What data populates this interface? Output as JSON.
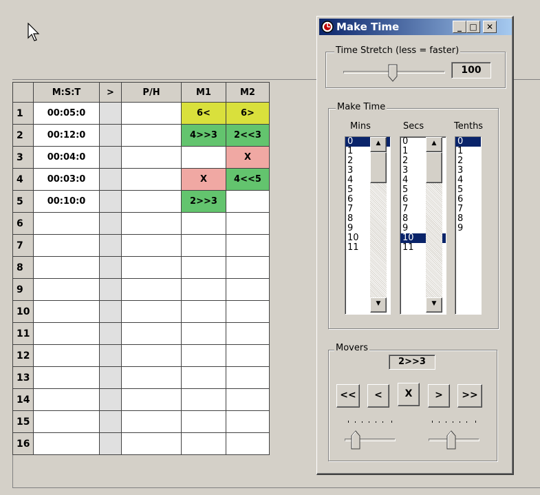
{
  "grid": {
    "headers": [
      "",
      "M:S:T",
      ">",
      "P/H",
      "M1",
      "M2"
    ],
    "rows": [
      {
        "num": "1",
        "time": "00:05:0",
        "m1": "6<",
        "m2": "6>"
      },
      {
        "num": "2",
        "time": "00:12:0",
        "m1": "4>>3",
        "m2": "2<<3"
      },
      {
        "num": "3",
        "time": "00:04:0",
        "m1": "",
        "m2": "X"
      },
      {
        "num": "4",
        "time": "00:03:0",
        "m1": "X",
        "m2": "4<<5"
      },
      {
        "num": "5",
        "time": "00:10:0",
        "m1": "2>>3",
        "m2": ""
      },
      {
        "num": "6",
        "time": "",
        "m1": "",
        "m2": ""
      },
      {
        "num": "7",
        "time": "",
        "m1": "",
        "m2": ""
      },
      {
        "num": "8",
        "time": "",
        "m1": "",
        "m2": ""
      },
      {
        "num": "9",
        "time": "",
        "m1": "",
        "m2": ""
      },
      {
        "num": "10",
        "time": "",
        "m1": "",
        "m2": ""
      },
      {
        "num": "11",
        "time": "",
        "m1": "",
        "m2": ""
      },
      {
        "num": "12",
        "time": "",
        "m1": "",
        "m2": ""
      },
      {
        "num": "13",
        "time": "",
        "m1": "",
        "m2": ""
      },
      {
        "num": "14",
        "time": "",
        "m1": "",
        "m2": ""
      },
      {
        "num": "15",
        "time": "",
        "m1": "",
        "m2": ""
      },
      {
        "num": "16",
        "time": "",
        "m1": "",
        "m2": ""
      }
    ]
  },
  "window": {
    "title": "Make Time",
    "minimize": "_",
    "maximize": "□",
    "close": "✕"
  },
  "stretch": {
    "label": "Time Stretch (less = faster)",
    "value": "100"
  },
  "make_time": {
    "label": "Make Time",
    "mins_label": "Mins",
    "secs_label": "Secs",
    "tenths_label": "Tenths",
    "mins": [
      "0",
      "1",
      "2",
      "3",
      "4",
      "5",
      "6",
      "7",
      "8",
      "9",
      "10",
      "11"
    ],
    "secs": [
      "0",
      "1",
      "2",
      "3",
      "4",
      "5",
      "6",
      "7",
      "8",
      "9",
      "10",
      "11"
    ],
    "tenths": [
      "0",
      "1",
      "2",
      "3",
      "4",
      "5",
      "6",
      "7",
      "8",
      "9"
    ],
    "mins_selected": "0",
    "secs_selected": "10",
    "tenths_selected": "0"
  },
  "movers": {
    "label": "Movers",
    "current": "2>>3",
    "buttons": [
      "<<",
      "<",
      "X",
      ">",
      ">>"
    ]
  },
  "colors": {
    "yellow": "#d9e03c",
    "green": "#63c46e",
    "pink": "#f0a8a3",
    "selection": "#0a246a"
  }
}
